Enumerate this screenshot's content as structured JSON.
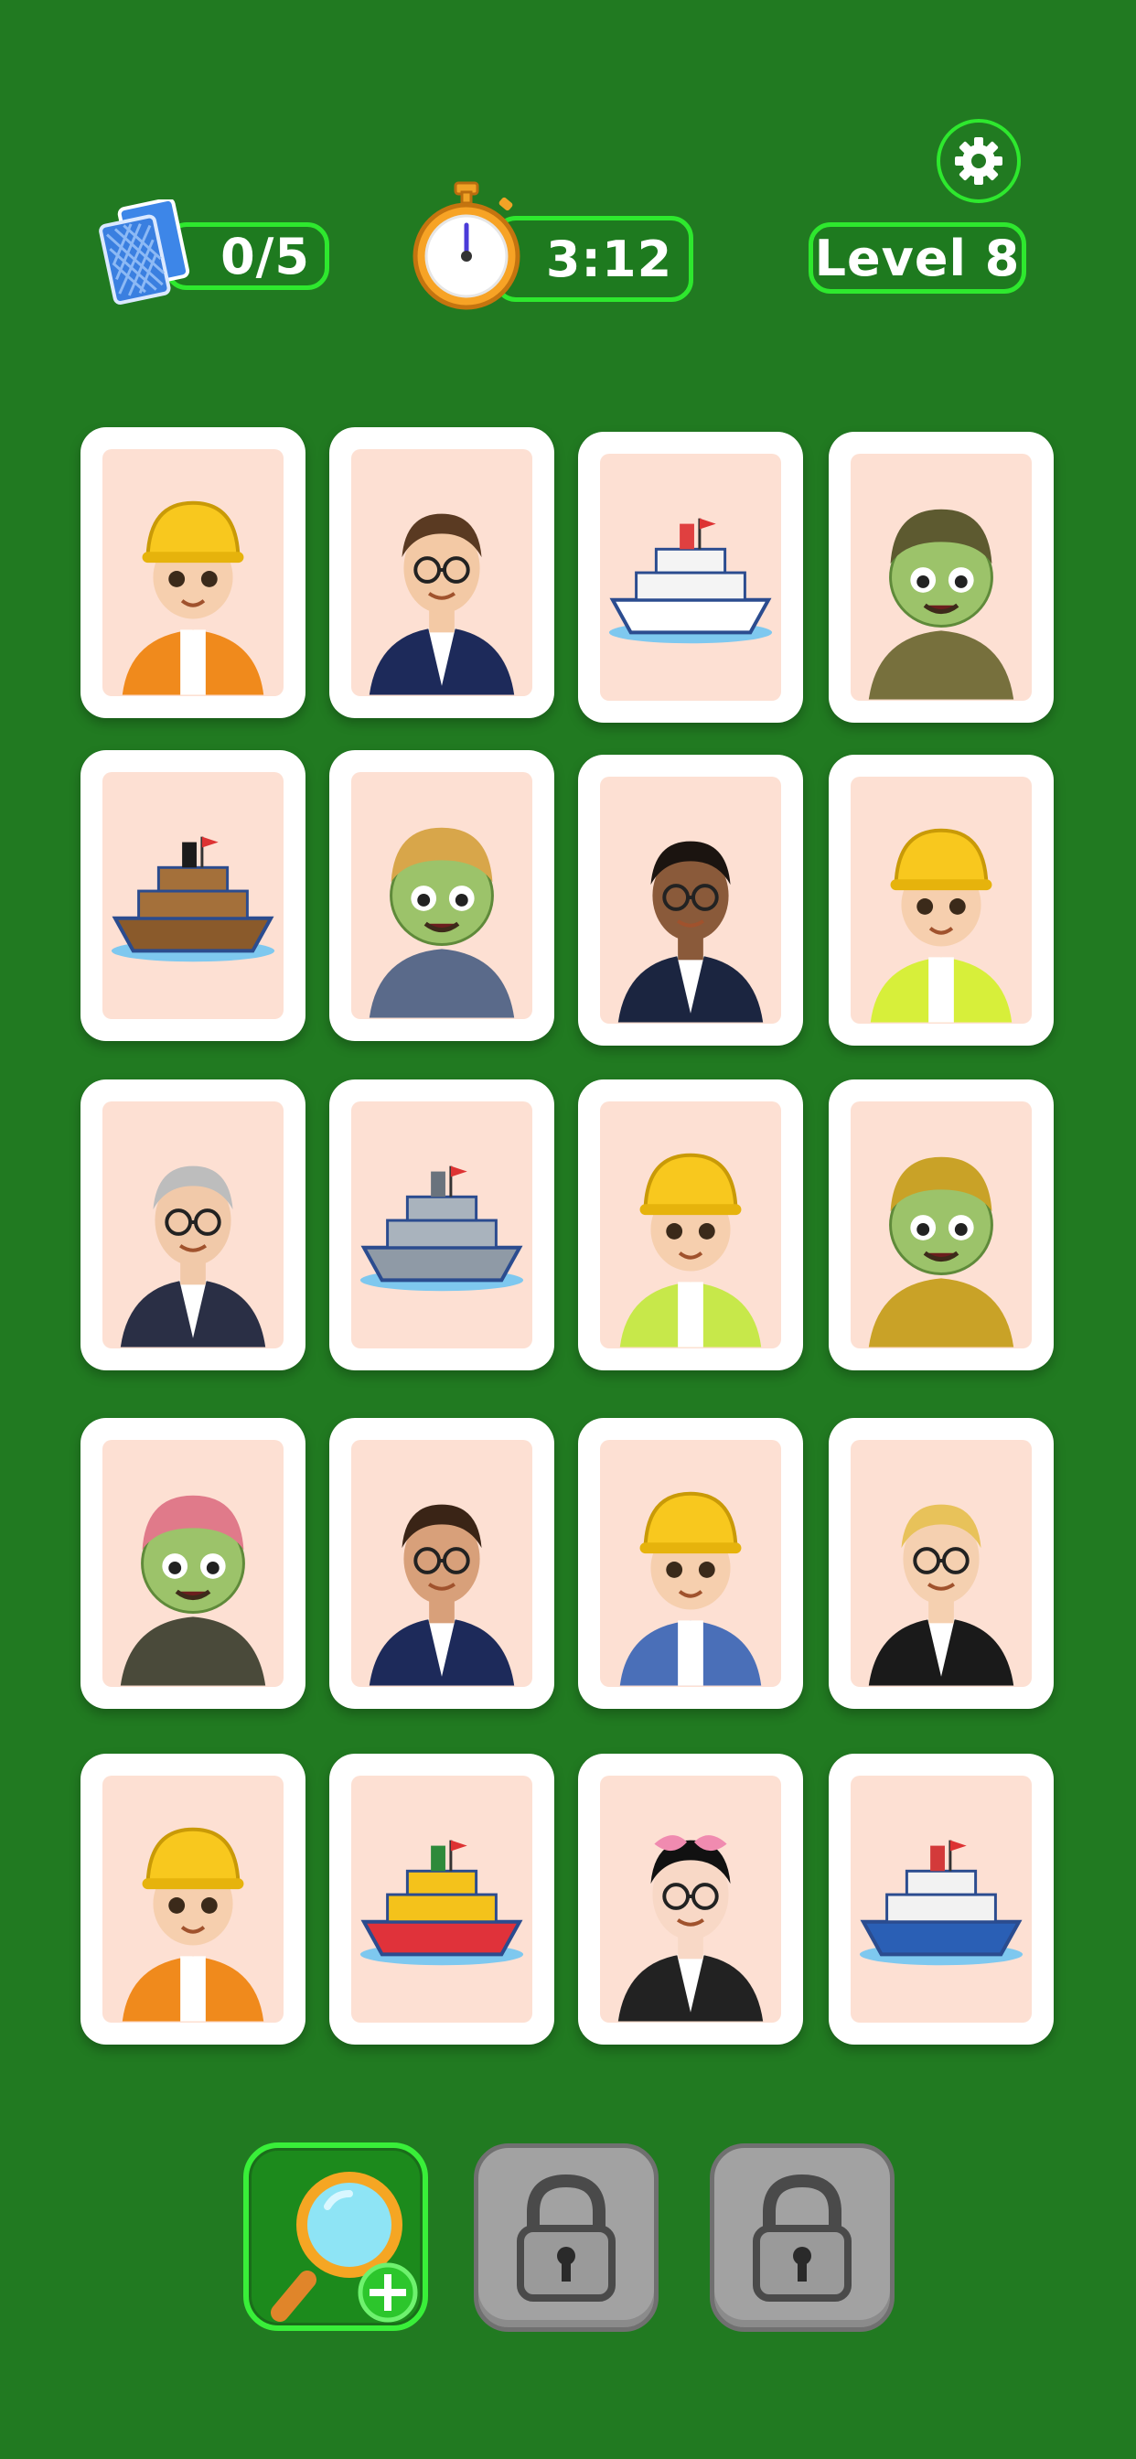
{
  "hud": {
    "pairs_found": "0/5",
    "timer": "3:12",
    "level": "Level 8"
  },
  "icons": {
    "settings": "gear-icon",
    "cards": "card-deck-icon",
    "timer": "stopwatch-icon",
    "hint": "magnifier-plus-icon",
    "locked": "padlock-icon"
  },
  "colors": {
    "background": "#217a21",
    "accent": "#2ee82e",
    "card_face": "#fde0d3"
  },
  "grid": [
    [
      "engineer-boy",
      "businessman-brown-hair",
      "cruise-ship",
      "zombie-soldier"
    ],
    [
      "pirate-ship",
      "zombie-farmer",
      "businessman-dark-skin",
      "engineer-girl-cone"
    ],
    [
      "businesswoman-gray-hair",
      "battleship",
      "engineer-girl-drill",
      "zombie-gas-mask"
    ],
    [
      "zombie-frankenstein",
      "businesswoman-brunette",
      "engineer-boy-blueprint",
      "businesswoman-blonde"
    ],
    [
      "engineer-boy-bricks",
      "toy-tugboat",
      "girl-pink-bow",
      "fishing-boat"
    ]
  ],
  "powerups": [
    {
      "name": "hint",
      "state": "available"
    },
    {
      "name": "locked-1",
      "state": "locked"
    },
    {
      "name": "locked-2",
      "state": "locked"
    }
  ]
}
